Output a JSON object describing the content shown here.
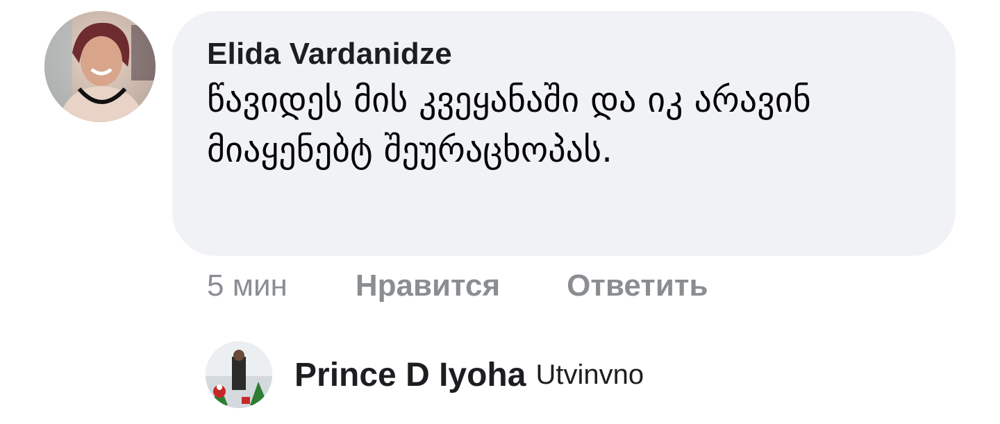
{
  "comment": {
    "author": "Elida Vardanidze",
    "text": "წავიდეს მის კვეყანაში და იკ არავინ მიაყენებტ შეურაცხოპას.",
    "time": "5 мин",
    "like_label": "Нравится",
    "reply_label": "Ответить"
  },
  "reply": {
    "author": "Prince D Iyoha",
    "text": "Utvinvno"
  },
  "colors": {
    "bubble": "#f0f2f5",
    "muted_text": "#8a8d91",
    "primary_text": "#1c1e21"
  }
}
